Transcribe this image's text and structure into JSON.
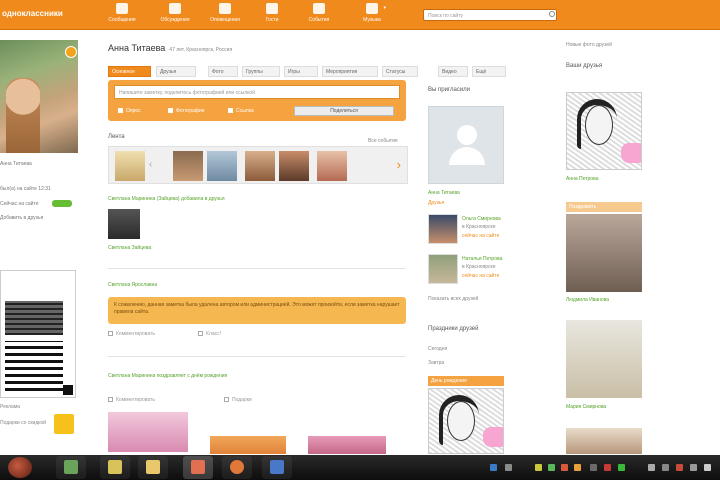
{
  "topbar": {
    "logo": "одноклассники",
    "nav": [
      {
        "label": "Сообщения",
        "icon": "envelope-icon"
      },
      {
        "label": "Обсуждения",
        "icon": "discussion-icon"
      },
      {
        "label": "Оповещения",
        "icon": "bell-icon"
      },
      {
        "label": "Гости",
        "icon": "guests-icon"
      },
      {
        "label": "События",
        "icon": "star-icon"
      },
      {
        "label": "Музыка",
        "icon": "music-icon"
      }
    ],
    "search_placeholder": "Поиск по сайту"
  },
  "profile": {
    "name": "Анна Титаева",
    "subtitle": "47 лет, Красноярск, Россия",
    "tabs": [
      "Основное",
      "Друзья",
      "Фото",
      "Группы",
      "Игры",
      "Мероприятия",
      "Статусы",
      "Видео",
      "Ещё"
    ],
    "status_placeholder": "Напишите заметку, поделитесь фотографией или ссылкой",
    "status_actions": [
      "Опрос",
      "Фотография",
      "Ссылка"
    ],
    "status_button": "Поделиться"
  },
  "left": {
    "info_lines": [
      "Анна Титаева",
      "был(а) на сайте 12:31",
      "Сейчас на сайте",
      "Добавить в друзья"
    ],
    "ad_label": "Реклама",
    "promo_text": "Подарки со скидкой"
  },
  "feed": {
    "header": "Лента",
    "header_right": "Все события",
    "photo_caption": "Светлана Маринина (Зайцева) добавила в друзья",
    "photo_link": "Светлана Зайцева",
    "group_link": "Светлана Ярославна",
    "notice": "К сожалению, данная заметка была удалена автором или администрацией. Это может произойти, если заметка нарушает правила сайта.",
    "actions": [
      "Комментировать",
      "Класс!"
    ],
    "bottom_caption": "Светлана Маринина поздравляет с днём рождения",
    "bottom_actions": [
      "Комментировать",
      "Подарки"
    ]
  },
  "invited": {
    "title": "Вы пригласили",
    "name": "Анна Титаева",
    "name_sub": "Друзья",
    "friends": [
      {
        "name": "Ольга Смирнова",
        "meta": "в Красноярске",
        "online": "сейчас на сайте"
      },
      {
        "name": "Наталья Петрова",
        "meta": "в Красноярске",
        "online": "сейчас на сайте"
      }
    ],
    "more": "Показать всех друзей"
  },
  "holidays": {
    "title": "Праздники друзей",
    "lines": [
      "Сегодня",
      "Завтра"
    ],
    "tag": "День рождения"
  },
  "right": {
    "top_link": "Новые фото друзей",
    "heading": "Ваши друзья",
    "captions": [
      "Анна Петрова",
      "Людмила Иванова",
      "Мария Смирнова"
    ],
    "tags": [
      "Поздравить"
    ]
  },
  "colors": {
    "accent": "#f08a1c",
    "link_green": "#57a32b"
  }
}
